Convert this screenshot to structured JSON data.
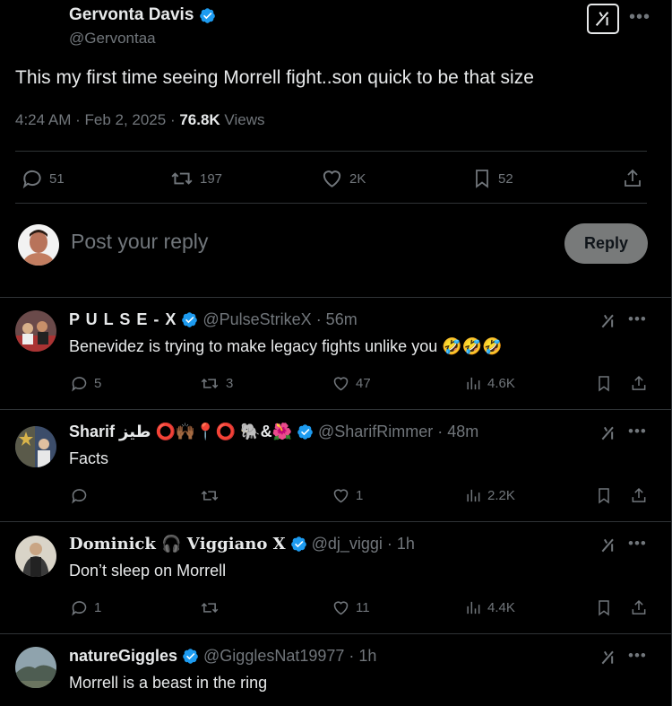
{
  "tweet": {
    "author_name": "Gervonta Davis",
    "author_handle": "@Gervontaa",
    "text": "This my first time seeing Morrell fight..son quick to be that size",
    "time": "4:24 AM · Feb 2, 2025 · ",
    "views_count": "76.8K",
    "views_label": " Views",
    "stats": {
      "replies": "51",
      "reposts": "197",
      "likes": "2K",
      "bookmarks": "52"
    }
  },
  "compose": {
    "placeholder": "Post your reply",
    "button_label": "Reply"
  },
  "replies": [
    {
      "name": "P U L S E - X",
      "handle": "@PulseStrikeX · 56m",
      "text": "Benevidez is trying to make legacy fights unlike you 🤣🤣🤣",
      "replies": "5",
      "reposts": "3",
      "likes": "47",
      "views": "4.6K"
    },
    {
      "name": "Sharif طيز ⭕🙌🏾📍⭕ 🐘&🌺",
      "handle": "@SharifRimmer · 48m",
      "text": "Facts",
      "replies": "",
      "reposts": "",
      "likes": "1",
      "views": "2.2K"
    },
    {
      "name": "𝐃𝐨𝐦𝐢𝐧𝐢𝐜𝐤 🎧 𝐕𝐢𝐠𝐠𝐢𝐚𝐧𝐨 𝐗",
      "handle": "@dj_viggi · 1h",
      "text": "Don’t sleep on Morrell",
      "replies": "1",
      "reposts": "",
      "likes": "11",
      "views": "4.4K"
    },
    {
      "name": "natureGiggles",
      "handle": "@GigglesNat19977 · 1h",
      "text": "Morrell is a beast in the ring",
      "replies": "",
      "reposts": "",
      "likes": "",
      "views": ""
    }
  ],
  "colors": {
    "accent": "#1d9bf0",
    "muted": "#71767b",
    "text": "#e7e9ea",
    "border": "#2f3336",
    "reply_button": "#787a7a"
  }
}
